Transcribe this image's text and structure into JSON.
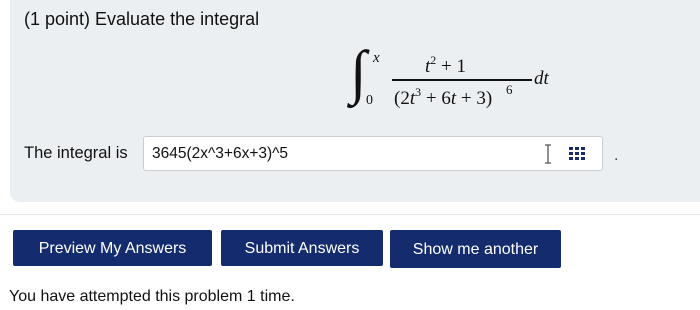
{
  "problem": {
    "heading": "(1 point) Evaluate the integral",
    "integral": {
      "upper_limit": "x",
      "lower_limit": "0",
      "numerator_var": "t",
      "numerator_exp": "2",
      "numerator_rest": " + 1",
      "den_open": "(2",
      "den_t1": "t",
      "den_exp1": "3",
      "den_mid": " + 6",
      "den_t2": "t",
      "den_close": " + 3)",
      "den_power": "6",
      "differential": "dt"
    }
  },
  "answer": {
    "label": "The integral is",
    "value": "3645(2x^3+6x+3)^5",
    "trailing": "."
  },
  "buttons": {
    "preview": "Preview My Answers",
    "submit": "Submit Answers",
    "another": "Show me another"
  },
  "status": {
    "attempts": "You have attempted this problem 1 time."
  },
  "colors": {
    "button_bg": "#142c6e",
    "panel_bg": "#eceff2"
  }
}
